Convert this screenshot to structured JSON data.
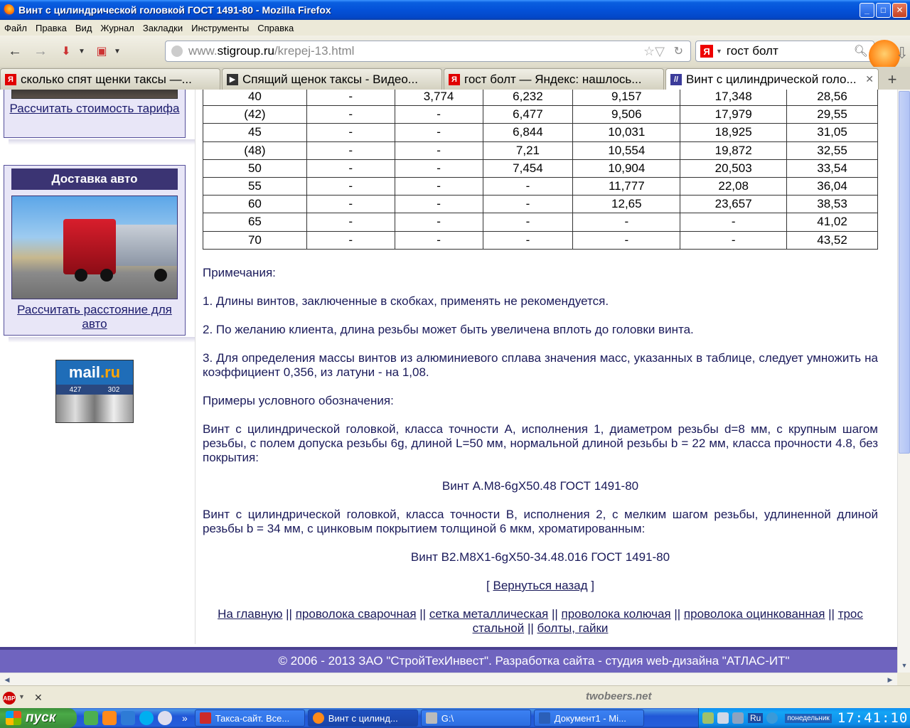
{
  "window": {
    "title": "Винт с цилиндрической головкой ГОСТ 1491-80 - Mozilla Firefox",
    "min": "_",
    "max": "□",
    "close": "✕"
  },
  "menu": [
    "Файл",
    "Правка",
    "Вид",
    "Журнал",
    "Закладки",
    "Инструменты",
    "Справка"
  ],
  "nav": {
    "url_prefix": "www.",
    "url_domain": "stigroup.ru",
    "url_path": "/krepej-13.html",
    "search_value": "гост болт",
    "search_engine_badge": "Я"
  },
  "tabs": [
    {
      "label": "сколько спят щенки таксы —...",
      "icon_color": "#e00000",
      "icon_glyph": "Я"
    },
    {
      "label": "Спящий щенок таксы - Видео...",
      "icon_color": "#333333",
      "icon_glyph": "▶"
    },
    {
      "label": "гост болт — Яндекс: нашлось...",
      "icon_color": "#e00000",
      "icon_glyph": "Я"
    },
    {
      "label": "Винт с цилиндрической голо...",
      "icon_color": "#3b3b9a",
      "icon_glyph": "//",
      "active": true
    }
  ],
  "new_tab": "+",
  "sidebar": {
    "box1_link": "Рассчитать стоимость тарифа",
    "box2_header": "Доставка авто",
    "box2_link": "Рассчитать расстояние для авто",
    "mail_logo_main": "mail",
    "mail_logo_ru": ".ru",
    "mail_count_1": "427",
    "mail_count_2": "302"
  },
  "table_rows": [
    [
      "40",
      "-",
      "3,774",
      "6,232",
      "9,157",
      "17,348",
      "28,56"
    ],
    [
      "(42)",
      "-",
      "-",
      "6,477",
      "9,506",
      "17,979",
      "29,55"
    ],
    [
      "45",
      "-",
      "-",
      "6,844",
      "10,031",
      "18,925",
      "31,05"
    ],
    [
      "(48)",
      "-",
      "-",
      "7,21",
      "10,554",
      "19,872",
      "32,55"
    ],
    [
      "50",
      "-",
      "-",
      "7,454",
      "10,904",
      "20,503",
      "33,54"
    ],
    [
      "55",
      "-",
      "-",
      "-",
      "11,777",
      "22,08",
      "36,04"
    ],
    [
      "60",
      "-",
      "-",
      "-",
      "12,65",
      "23,657",
      "38,53"
    ],
    [
      "65",
      "-",
      "-",
      "-",
      "-",
      "-",
      "41,02"
    ],
    [
      "70",
      "-",
      "-",
      "-",
      "-",
      "-",
      "43,52"
    ]
  ],
  "notes": {
    "heading": "Примечания:",
    "n1": "1. Длины винтов, заключенные в скобках, применять не рекомендуется.",
    "n2": "2. По желанию клиента, длина резьбы может быть увеличена вплоть до головки винта.",
    "n3": "3. Для определения массы винтов из алюминиевого сплава значения масс, указанных в таблице, следует умножить на коэффициент 0,356, из латуни - на 1,08.",
    "examples_heading": "Примеры условного обозначения:",
    "ex1": "Винт с цилиндрической головкой, класса точности А, исполнения 1, диаметром резьбы d=8 мм, с крупным шагом резьбы, с полем допуска резьбы 6g, длиной L=50 мм, нормальной длиной резьбы b = 22 мм, класса прочности 4.8, без покрытия:",
    "ex1_code": "Винт А.М8-6gX50.48 ГОСТ 1491-80",
    "ex2": "Винт с цилиндрической головкой, класса точности В, исполнения 2, с мелким шагом резьбы, удлиненной длиной резьбы b = 34 мм, с цинковым покрытием толщиной 6 мкм, хроматированным:",
    "ex2_code": "Винт В2.М8X1-6gX50-34.48.016 ГОСТ 1491-80",
    "back_open": "[ ",
    "back_link": "Вернуться назад",
    "back_close": " ]"
  },
  "bottom_links": [
    "На главную",
    "проволока сварочная",
    "сетка металлическая",
    "проволока колючая",
    "проволока оцинкованная",
    "трос стальной",
    "болты, гайки"
  ],
  "link_separator": " || ",
  "footer": "© 2006 - 2013 ЗАО \"СтройТехИнвест\". Разработка сайта - студия web-дизайна \"АТЛАС-ИТ\"",
  "addon": {
    "abp_label": "ABP",
    "close": "✕",
    "twobeers": "twobeers.net"
  },
  "taskbar": {
    "start": "пуск",
    "more": "»",
    "tasks": [
      {
        "label": "Такса-сайт. Все...",
        "icon_color": "#cc2a2a"
      },
      {
        "label": "Винт с цилинд...",
        "icon_color": "#ff8a1a",
        "active": true
      },
      {
        "label": "G:\\",
        "icon_color": "#bbbbbb"
      },
      {
        "label": "Документ1 - Mi...",
        "icon_color": "#2b5fb8"
      }
    ],
    "lang": "Ru",
    "day": "понедельник",
    "clock": "17:41:10"
  }
}
